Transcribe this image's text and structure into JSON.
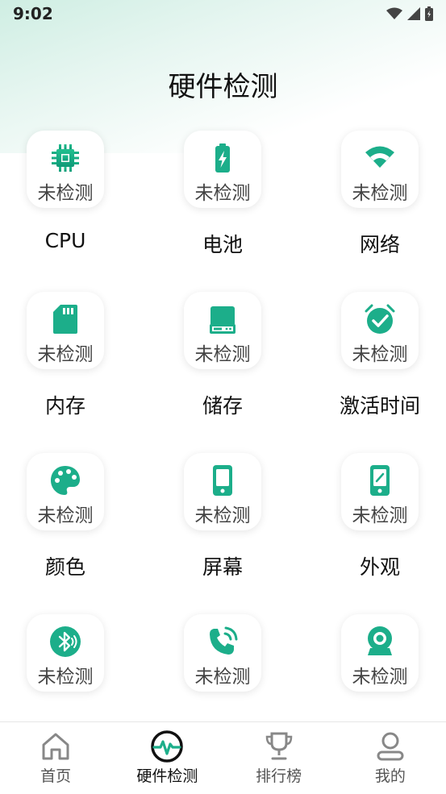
{
  "status": {
    "time": "9:02"
  },
  "title": "硬件检测",
  "items": [
    {
      "label": "CPU",
      "status": "未检测",
      "icon": "cpu-icon"
    },
    {
      "label": "电池",
      "status": "未检测",
      "icon": "battery-icon"
    },
    {
      "label": "网络",
      "status": "未检测",
      "icon": "wifi-icon"
    },
    {
      "label": "内存",
      "status": "未检测",
      "icon": "sd-card-icon"
    },
    {
      "label": "储存",
      "status": "未检测",
      "icon": "storage-icon"
    },
    {
      "label": "激活时间",
      "status": "未检测",
      "icon": "alarm-check-icon"
    },
    {
      "label": "颜色",
      "status": "未检测",
      "icon": "palette-icon"
    },
    {
      "label": "屏幕",
      "status": "未检测",
      "icon": "phone-screen-icon"
    },
    {
      "label": "外观",
      "status": "未检测",
      "icon": "phone-appearance-icon"
    },
    {
      "label": "",
      "status": "未检测",
      "icon": "bluetooth-icon"
    },
    {
      "label": "",
      "status": "未检测",
      "icon": "phone-call-icon"
    },
    {
      "label": "",
      "status": "未检测",
      "icon": "camera-icon"
    }
  ],
  "nav": [
    {
      "label": "首页",
      "icon": "home-icon"
    },
    {
      "label": "硬件检测",
      "icon": "pulse-icon"
    },
    {
      "label": "排行榜",
      "icon": "trophy-icon"
    },
    {
      "label": "我的",
      "icon": "user-icon"
    }
  ],
  "colors": {
    "accent": "#1cae8a",
    "accent_dark": "#0f9a78"
  }
}
